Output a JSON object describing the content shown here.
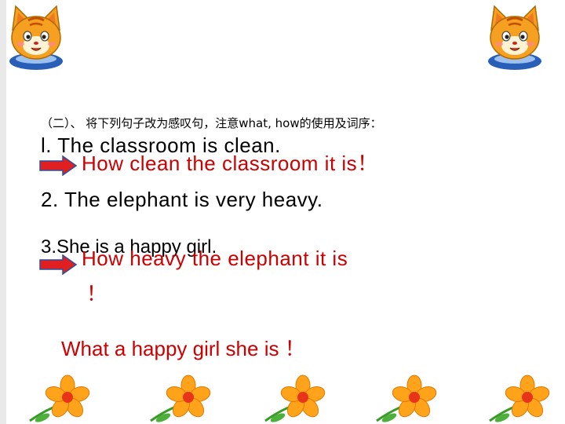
{
  "header": {
    "left_icon": "cartoon-cat-icon",
    "right_icon": "cartoon-cat-icon"
  },
  "content": {
    "instruction": "（二）、 将下列句子改为感叹句，注意what, how的使用及词序：",
    "sentence_1": "l. The classroom is clean.",
    "answer_1": "How clean the classroom it is！",
    "sentence_2": "2. The elephant is very heavy.",
    "sentence_3": "3.She is a happy girl.",
    "answer_2": "How heavy the elephant it is",
    "answer_2_mark": "！",
    "answer_3": "What a happy  girl she is ！"
  },
  "footer": {
    "decoration_icon": "orange-flower-icon"
  },
  "colors": {
    "answer_text": "#cc0000",
    "arrow_fill": "#e02020",
    "arrow_stroke": "#2d4f9e",
    "flower_petal": "#ffa41a",
    "flower_center": "#e8341a",
    "background": "#ffffff"
  }
}
